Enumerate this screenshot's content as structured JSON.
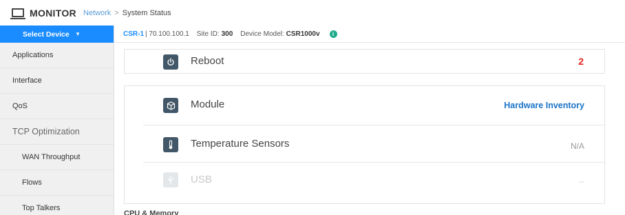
{
  "header": {
    "title": "MONITOR",
    "breadcrumb": {
      "link": "Network",
      "separator": ">",
      "current": "System Status"
    }
  },
  "sidebar": {
    "select_device": "Select Device",
    "items": [
      {
        "label": "Applications"
      },
      {
        "label": "Interface"
      },
      {
        "label": "QoS"
      },
      {
        "label": "TCP Optimization"
      },
      {
        "label": "WAN Throughput"
      },
      {
        "label": "Flows"
      },
      {
        "label": "Top Talkers"
      }
    ]
  },
  "device": {
    "name": "CSR-1",
    "ip": "| 70.100.100.1",
    "site_id_label": "Site ID:",
    "site_id": "300",
    "model_label": "Device Model:",
    "model": "CSR1000v",
    "info_icon": "info-icon"
  },
  "reboot": {
    "label": "Reboot",
    "count": "2",
    "icon": "power-icon"
  },
  "status_rows": [
    {
      "label": "Module",
      "value": "Hardware Inventory",
      "icon": "cube-icon"
    },
    {
      "label": "Temperature Sensors",
      "value": "N/A",
      "icon": "thermometer-icon"
    },
    {
      "label": "USB",
      "value": "--",
      "icon": "usb-icon"
    }
  ],
  "next_section": "CPU & Memory",
  "colors": {
    "accent": "#1a8cff",
    "alert": "#e0241b",
    "link": "#1a73c8",
    "icon_bg": "#425868"
  }
}
